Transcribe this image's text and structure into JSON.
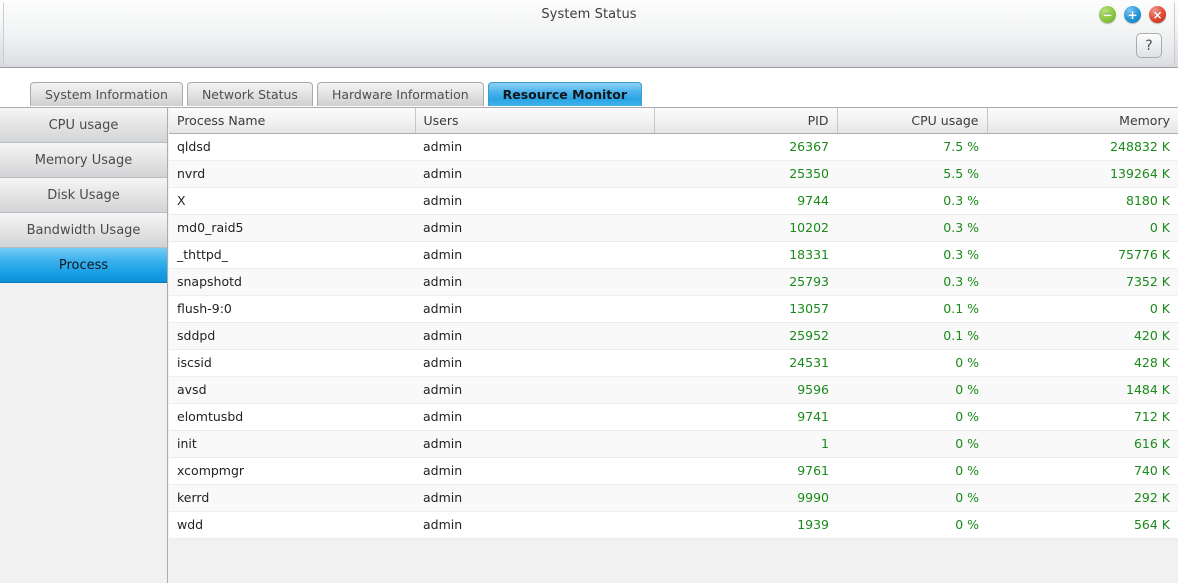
{
  "window": {
    "title": "System Status",
    "controls": [
      {
        "name": "minimize-button",
        "icon": "minus-icon",
        "glyph": "−",
        "color": "#8cc63f"
      },
      {
        "name": "maximize-button",
        "icon": "plus-icon",
        "glyph": "+",
        "color": "#2196d9"
      },
      {
        "name": "close-button",
        "icon": "close-icon",
        "glyph": "×",
        "color": "#e04430"
      }
    ],
    "help_label": "?"
  },
  "tabs": [
    {
      "label": "System Information",
      "active": false
    },
    {
      "label": "Network Status",
      "active": false
    },
    {
      "label": "Hardware Information",
      "active": false
    },
    {
      "label": "Resource Monitor",
      "active": true
    }
  ],
  "sidebar": {
    "items": [
      {
        "label": "CPU usage",
        "selected": false
      },
      {
        "label": "Memory Usage",
        "selected": false
      },
      {
        "label": "Disk Usage",
        "selected": false
      },
      {
        "label": "Bandwidth Usage",
        "selected": false
      },
      {
        "label": "Process",
        "selected": true
      }
    ]
  },
  "table": {
    "columns": [
      {
        "key": "name",
        "label": "Process Name",
        "align": "left"
      },
      {
        "key": "users",
        "label": "Users",
        "align": "left"
      },
      {
        "key": "pid",
        "label": "PID",
        "align": "right"
      },
      {
        "key": "cpu",
        "label": "CPU usage",
        "align": "right"
      },
      {
        "key": "memory",
        "label": "Memory",
        "align": "right"
      }
    ],
    "rows": [
      {
        "name": "qldsd",
        "users": "admin",
        "pid": "26367",
        "cpu": "7.5 %",
        "memory": "248832 K"
      },
      {
        "name": "nvrd",
        "users": "admin",
        "pid": "25350",
        "cpu": "5.5 %",
        "memory": "139264 K"
      },
      {
        "name": "X",
        "users": "admin",
        "pid": "9744",
        "cpu": "0.3 %",
        "memory": "8180 K"
      },
      {
        "name": "md0_raid5",
        "users": "admin",
        "pid": "10202",
        "cpu": "0.3 %",
        "memory": "0 K"
      },
      {
        "name": "_thttpd_",
        "users": "admin",
        "pid": "18331",
        "cpu": "0.3 %",
        "memory": "75776 K"
      },
      {
        "name": "snapshotd",
        "users": "admin",
        "pid": "25793",
        "cpu": "0.3 %",
        "memory": "7352 K"
      },
      {
        "name": "flush-9:0",
        "users": "admin",
        "pid": "13057",
        "cpu": "0.1 %",
        "memory": "0 K"
      },
      {
        "name": "sddpd",
        "users": "admin",
        "pid": "25952",
        "cpu": "0.1 %",
        "memory": "420 K"
      },
      {
        "name": "iscsid",
        "users": "admin",
        "pid": "24531",
        "cpu": "0 %",
        "memory": "428 K"
      },
      {
        "name": "avsd",
        "users": "admin",
        "pid": "9596",
        "cpu": "0 %",
        "memory": "1484 K"
      },
      {
        "name": "elomtusbd",
        "users": "admin",
        "pid": "9741",
        "cpu": "0 %",
        "memory": "712 K"
      },
      {
        "name": "init",
        "users": "admin",
        "pid": "1",
        "cpu": "0 %",
        "memory": "616 K"
      },
      {
        "name": "xcompmgr",
        "users": "admin",
        "pid": "9761",
        "cpu": "0 %",
        "memory": "740 K"
      },
      {
        "name": "kerrd",
        "users": "admin",
        "pid": "9990",
        "cpu": "0 %",
        "memory": "292 K"
      },
      {
        "name": "wdd",
        "users": "admin",
        "pid": "1939",
        "cpu": "0 %",
        "memory": "564 K"
      }
    ]
  },
  "colors": {
    "accent_blue": "#17a0e6",
    "numeric_green": "#1a8a1a",
    "panel_gray": "#f1f1f1"
  }
}
